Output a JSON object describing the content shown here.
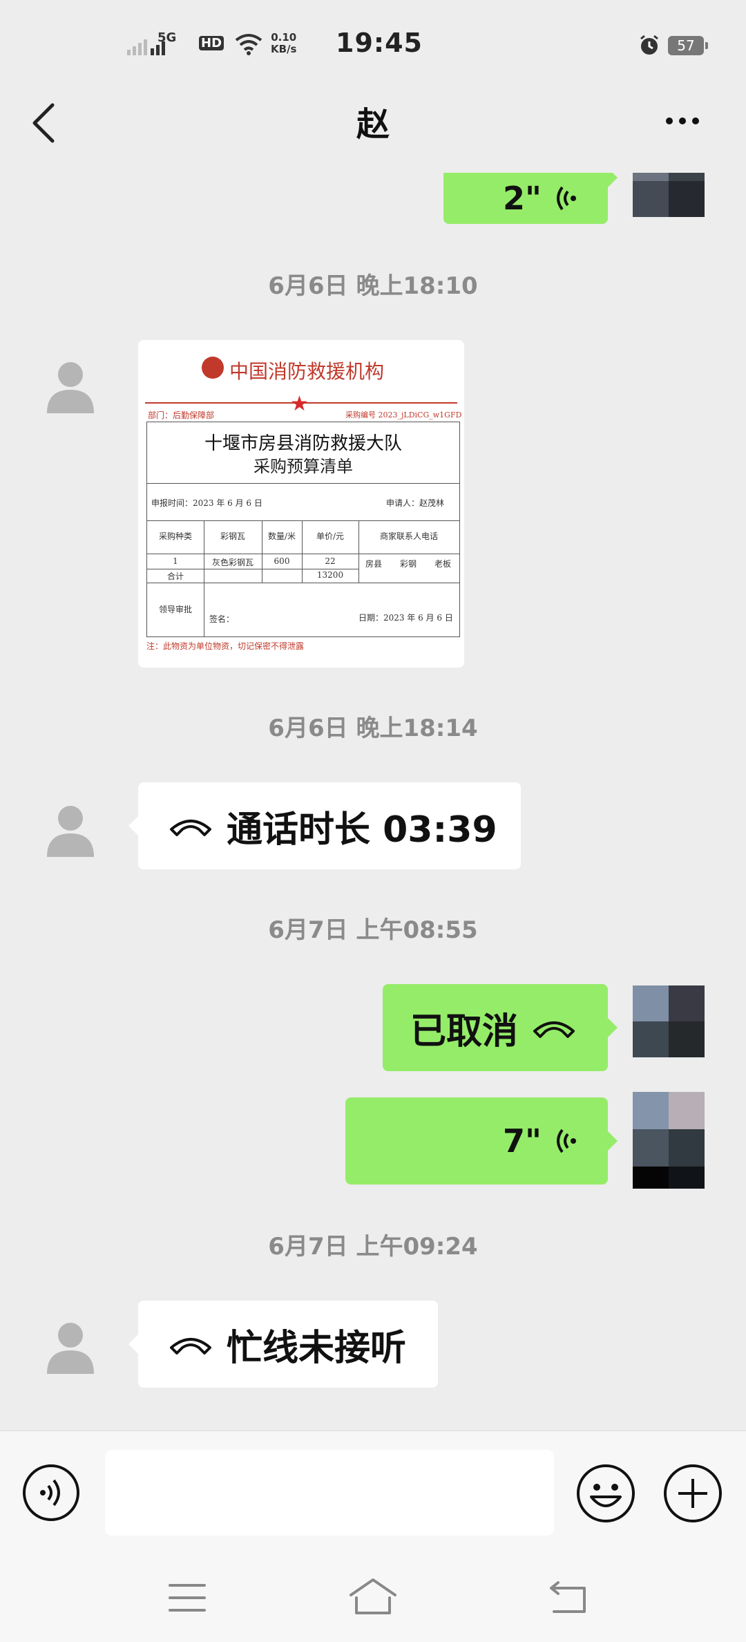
{
  "status_bar": {
    "network": "5G",
    "hd": "HD",
    "speed_value": "0.10",
    "speed_unit": "KB/s",
    "time": "19:45",
    "battery": "57"
  },
  "header": {
    "title": "赵"
  },
  "messages": [
    {
      "type": "voice",
      "direction": "out",
      "duration": "2\""
    },
    {
      "type": "timestamp",
      "text": "6月6日 晚上18:10"
    },
    {
      "type": "image",
      "direction": "in"
    },
    {
      "type": "timestamp",
      "text": "6月6日 晚上18:14"
    },
    {
      "type": "call",
      "direction": "in",
      "text": "通话时长 03:39"
    },
    {
      "type": "timestamp",
      "text": "6月7日 上午08:55"
    },
    {
      "type": "call",
      "direction": "out",
      "text": "已取消"
    },
    {
      "type": "voice",
      "direction": "out",
      "duration": "7\""
    },
    {
      "type": "timestamp",
      "text": "6月7日 上午09:24"
    },
    {
      "type": "call",
      "direction": "in",
      "text": "忙线未接听"
    }
  ],
  "document": {
    "org": "中国消防救援机构",
    "dept": "部门：后勤保障部",
    "number": "采购编号 2023_jLDiCG_w1GFD",
    "title_line1": "十堰市房县消防救援大队",
    "title_line2": "采购预算清单",
    "report_time": "申报时间：2023 年 6 月 6 日",
    "applicant": "申请人：赵茂林",
    "headers": [
      "采购种类",
      "彩钢瓦",
      "数量/米",
      "单价/元",
      "商家联系人电话"
    ],
    "row1": [
      "1",
      "灰色彩钢瓦",
      "600",
      "22",
      "房县",
      "彩钢",
      "老板"
    ],
    "total_label": "合计",
    "total_value": "13200",
    "approval_label": "领导审批",
    "sign_label": "签名：",
    "date_label": "日期：2023 年 6 月 6 日",
    "note": "注：此物资为单位物资，切记保密不得泄露"
  },
  "input": {
    "placeholder": ""
  },
  "colors": {
    "bubble_out": "#95ec69",
    "bubble_in": "#ffffff",
    "background": "#ededed",
    "timestamp": "#8a8a8a"
  }
}
